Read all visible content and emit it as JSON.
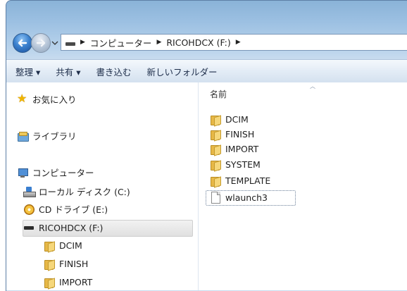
{
  "address_bar": {
    "crumbs": [
      "コンピューター",
      "RICOHDCX (F:)"
    ]
  },
  "command_bar": {
    "organize": "整理 ▾",
    "share": "共有 ▾",
    "burn": "書き込む",
    "new_folder": "新しいフォルダー"
  },
  "nav_pane": {
    "favorites": "お気に入り",
    "libraries": "ライブラリ",
    "computer": "コンピューター",
    "local_disk": "ローカル ディスク (C:)",
    "cd_drive": "CD ドライブ (E:)",
    "ricoh_drive": "RICOHDCX (F:)",
    "subfolders": [
      "DCIM",
      "FINISH",
      "IMPORT"
    ]
  },
  "file_list": {
    "column_name": "名前",
    "items": [
      {
        "name": "DCIM",
        "type": "folder"
      },
      {
        "name": "FINISH",
        "type": "folder"
      },
      {
        "name": "IMPORT",
        "type": "folder"
      },
      {
        "name": "SYSTEM",
        "type": "folder"
      },
      {
        "name": "TEMPLATE",
        "type": "folder"
      },
      {
        "name": "wlaunch3",
        "type": "file"
      }
    ]
  },
  "colors": {
    "window_frame": "#9cc0e2",
    "folder": "#e7b847",
    "selection": "#e0e0e0"
  }
}
